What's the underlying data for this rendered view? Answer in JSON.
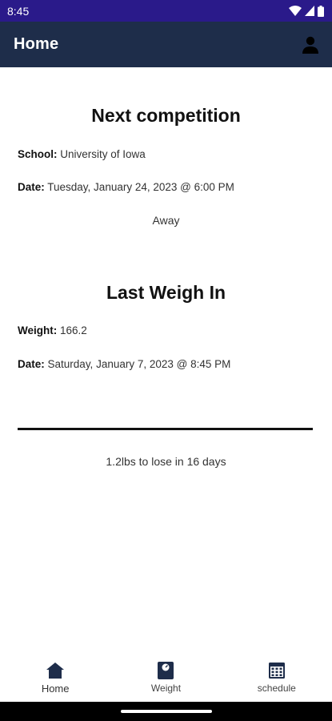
{
  "status_bar": {
    "time": "8:45",
    "icons": [
      "wifi-icon",
      "signal-icon",
      "battery-icon"
    ]
  },
  "app_bar": {
    "title": "Home",
    "profile_icon": "person-icon"
  },
  "next_competition": {
    "heading": "Next competition",
    "school_label": "School:",
    "school_value": "University of Iowa",
    "date_label": "Date:",
    "date_value": "Tuesday, January 24, 2023 @ 6:00 PM",
    "location": "Away"
  },
  "last_weigh_in": {
    "heading": "Last Weigh In",
    "weight_label": "Weight:",
    "weight_value": "166.2",
    "date_label": "Date:",
    "date_value": "Saturday, January 7, 2023 @ 8:45 PM"
  },
  "progress": {
    "fraction": 1.0,
    "summary": "1.2lbs to lose in 16 days"
  },
  "bottom_nav": {
    "items": [
      {
        "label": "Home",
        "icon": "home-icon",
        "active": true
      },
      {
        "label": "Weight",
        "icon": "scale-icon",
        "active": false
      },
      {
        "label": "schedule",
        "icon": "calendar-icon",
        "active": false
      }
    ]
  },
  "colors": {
    "status_bar": "#2a1a8a",
    "app_bar": "#1e2d4a",
    "nav_icon": "#1e2d4a",
    "progress": "#111111"
  }
}
